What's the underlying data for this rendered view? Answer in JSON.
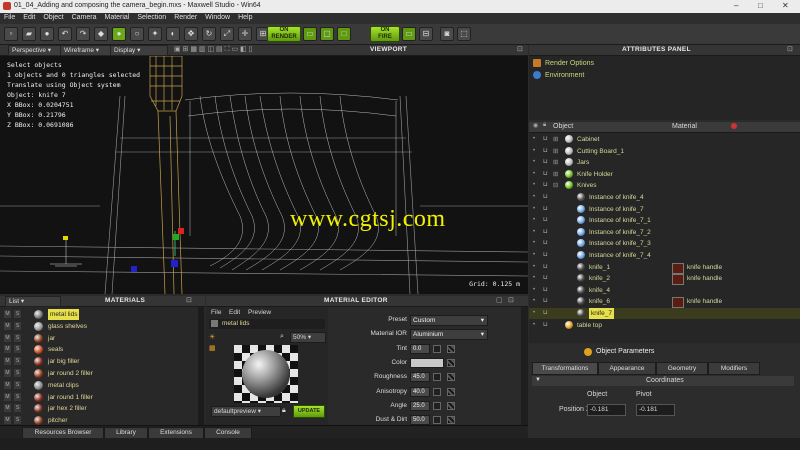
{
  "window": {
    "title": "01_04_Adding and composing the camera_begin.mxs - Maxwell Studio - Win64"
  },
  "menu": [
    "File",
    "Edit",
    "Object",
    "Camera",
    "Material",
    "Selection",
    "Render",
    "Window",
    "Help"
  ],
  "toolbar": {
    "render_label": "RENDER",
    "fire_label": "FIRE",
    "on_label": "ON"
  },
  "viewport": {
    "title": "VIEWPORT",
    "perspective": "Perspective",
    "wireframe": "Wireframe",
    "display": "Display",
    "info": [
      "Select objects",
      "1 objects and 0 triangles selected",
      "Translate using Object system",
      "Object: knife 7",
      "X BBox: 0.0204751",
      "Y BBox: 0.21796",
      "Z BBox: 0.0691086"
    ],
    "grid": "Grid: 0.125 m",
    "watermark": "www.cgtsj.com"
  },
  "attributes": {
    "title": "ATTRIBUTES PANEL",
    "items": [
      "Render Options",
      "Environment"
    ],
    "col_object": "Object",
    "col_material": "Material"
  },
  "objects": [
    {
      "name": "Cabinet",
      "level": 1,
      "mat": ""
    },
    {
      "name": "Cutting Board_1",
      "level": 1,
      "mat": ""
    },
    {
      "name": "Jars",
      "level": 1,
      "mat": ""
    },
    {
      "name": "Knife Holder",
      "level": 1,
      "mat": ""
    },
    {
      "name": "Knives",
      "level": 1,
      "mat": ""
    },
    {
      "name": "Instance of knife_4",
      "level": 2,
      "mat": ""
    },
    {
      "name": "Instance of knife_7",
      "level": 2,
      "mat": ""
    },
    {
      "name": "Instance of knife_7_1",
      "level": 2,
      "mat": ""
    },
    {
      "name": "Instance of knife_7_2",
      "level": 2,
      "mat": ""
    },
    {
      "name": "Instance of knife_7_3",
      "level": 2,
      "mat": ""
    },
    {
      "name": "Instance of knife_7_4",
      "level": 2,
      "mat": ""
    },
    {
      "name": "knife_1",
      "level": 2,
      "mat": "knife handle"
    },
    {
      "name": "knife_2",
      "level": 2,
      "mat": "knife handle"
    },
    {
      "name": "knife_4",
      "level": 2,
      "mat": ""
    },
    {
      "name": "knife_6",
      "level": 2,
      "mat": "knife handle"
    },
    {
      "name": "knife_7",
      "level": 2,
      "mat": ""
    },
    {
      "name": "table top",
      "level": 1,
      "mat": ""
    }
  ],
  "object_params": {
    "title": "Object Parameters",
    "tabs": [
      "Transformations",
      "Appearance",
      "Geometry",
      "Modifiers"
    ],
    "section": "Coordinates",
    "col_object": "Object",
    "col_pivot": "Pivot",
    "position_label": "Position X",
    "position_object": "-0.181",
    "position_pivot": "-0.181"
  },
  "materials": {
    "title": "MATERIALS",
    "list_label": "List",
    "items": [
      "metal lids",
      "glass shelves",
      "jar",
      "seals",
      "jar big filler",
      "jar round 2 filler",
      "metal clips",
      "jar round 1 filler",
      "jar hex 2 filler",
      "pitcher"
    ]
  },
  "material_editor": {
    "title": "MATERIAL EDITOR",
    "menu": [
      "File",
      "Edit",
      "Preview"
    ],
    "material_name": "metal lids",
    "zoom": "50%",
    "preview_mode": "defaultpreview",
    "update_label": "UPDATE",
    "props": [
      {
        "label": "Preset",
        "value": "Custom",
        "kind": "drop"
      },
      {
        "label": "Material IOR",
        "value": "Aluminium",
        "kind": "drop"
      },
      {
        "label": "Tint",
        "value": "0.0",
        "kind": "num"
      },
      {
        "label": "Color",
        "value": "",
        "kind": "color"
      },
      {
        "label": "Roughness",
        "value": "45.0",
        "kind": "num"
      },
      {
        "label": "Anisotropy",
        "value": "40.0",
        "kind": "num"
      },
      {
        "label": "Angle",
        "value": "25.0",
        "kind": "num"
      },
      {
        "label": "Dust & Dirt",
        "value": "50.0",
        "kind": "num"
      }
    ]
  },
  "bottom_tabs": [
    "Resources Browser",
    "Library",
    "Extensions",
    "Console"
  ],
  "colors": {
    "accent_green": "#8ccf1e",
    "selection_yellow": "#e8e04a",
    "wire_gold": "#c9a04a"
  }
}
